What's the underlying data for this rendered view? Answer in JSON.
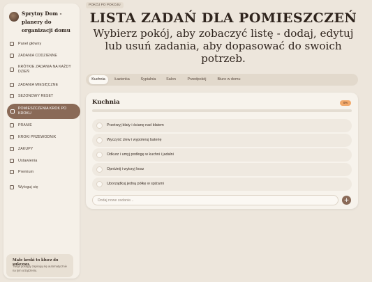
{
  "app": {
    "title": "Sprytny Dom - planery do organizacji domu"
  },
  "sidebar": {
    "items": [
      {
        "label": "Panel główny",
        "icon": "grid-icon"
      },
      {
        "label": "ZADANIA CODZIENNE",
        "icon": "sun-icon"
      },
      {
        "label": "KRÓTKIE ZADANIA NA KAŻDY DZIEŃ",
        "icon": "calendar-icon"
      },
      {
        "label": "ZADANIA MIESIĘCZNE",
        "icon": "calendar-month-icon"
      },
      {
        "label": "SEZONOWY RESET",
        "icon": "leaf-icon"
      },
      {
        "label": "POMIESZCZENIA KROK PO KROKU",
        "icon": "home-icon",
        "active": true
      },
      {
        "label": "PRANIE",
        "icon": "shirt-icon"
      },
      {
        "label": "KROKI PRZEWODNIK",
        "icon": "footsteps-icon"
      },
      {
        "label": "ZAKUPY",
        "icon": "cart-icon"
      },
      {
        "label": "Ustawienia",
        "icon": "gear-icon"
      },
      {
        "label": "Premium",
        "icon": "crown-icon"
      },
      {
        "label": "Wyloguj się",
        "icon": "logout-icon"
      }
    ],
    "tip": {
      "title": "Małe kroki to klucz do sukcesu.",
      "text": "Twoje postępy zapisują się automatycznie na tym urządzeniu."
    }
  },
  "header": {
    "badge": "POKÓJ PO POKOJU",
    "title": "LISTA ZADAŃ DLA POMIESZCZEŃ",
    "subtitle": "Wybierz pokój, aby zobaczyć listę - dodaj, edytuj lub usuń zadania, aby dopasować do swoich potrzeb."
  },
  "tabs": [
    {
      "label": "Kuchnia",
      "active": true
    },
    {
      "label": "Łazienka"
    },
    {
      "label": "Sypialnia"
    },
    {
      "label": "Salon"
    },
    {
      "label": "Przedpokój"
    },
    {
      "label": "Biuro w domu"
    }
  ],
  "room": {
    "name": "Kuchnia",
    "progress": 0,
    "progress_label": "0%",
    "tasks": [
      {
        "label": "Przetrzyj blaty i ścianę nad blatem",
        "done": false
      },
      {
        "label": "Wyczyść zlew i wypoleruj baterię",
        "done": false
      },
      {
        "label": "Odkurz i umyj podłogę w kuchni i jadalni",
        "done": false
      },
      {
        "label": "Opróżnij i wytrzyj kosz",
        "done": false
      },
      {
        "label": "Uporządkuj jedną półkę w spiżarni",
        "done": false
      }
    ],
    "add_placeholder": "Dodaj nowe zadanie...",
    "add_button": "+"
  },
  "colors": {
    "background": "#ede6dc",
    "accent": "#8a6a57",
    "progress_badge": "#f2a96b"
  }
}
